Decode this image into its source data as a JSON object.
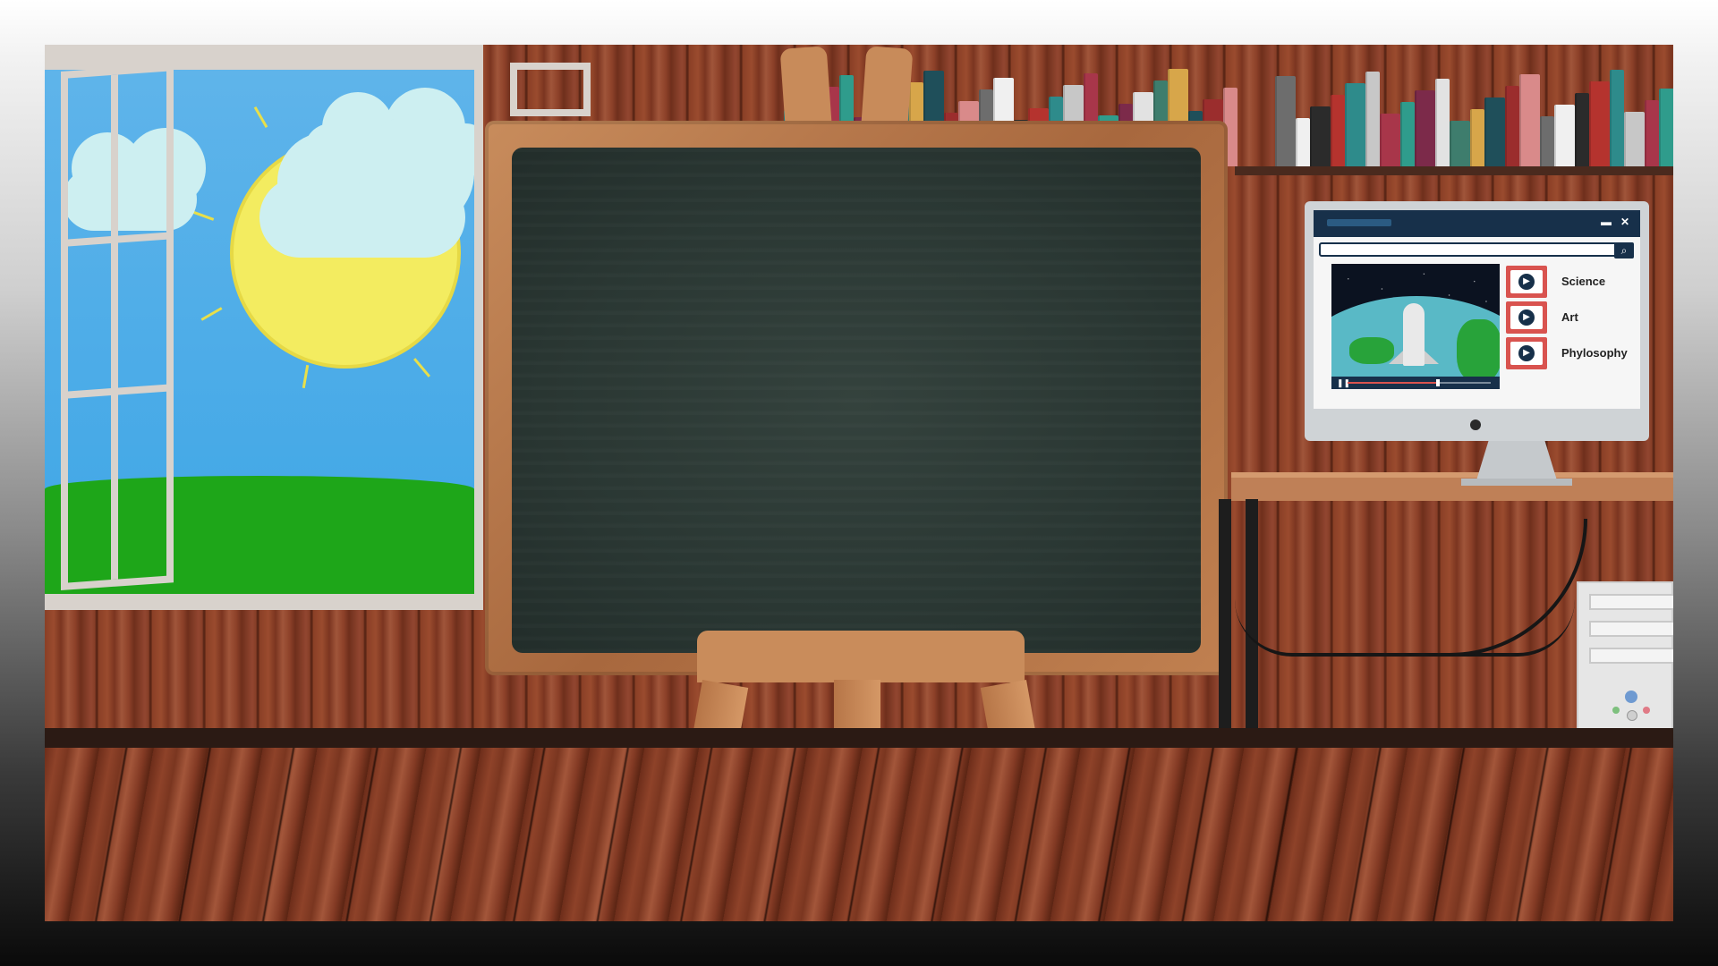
{
  "monitor": {
    "videos": [
      {
        "label": "Science"
      },
      {
        "label": "Art"
      },
      {
        "label": "Phylosophy"
      }
    ],
    "player": {
      "progress": 0.62
    },
    "icons": [
      "minimize-icon",
      "close-icon",
      "search-icon",
      "play-icon",
      "pause-icon"
    ]
  },
  "colors": {
    "sky": "#3ea6e6",
    "grass": "#1ea619",
    "sun": "#f3ec60",
    "chalkboard": "#2a3733",
    "frame_wood": "#c88c5c",
    "screen_header": "#17304a",
    "thumbnail_red": "#d9534f"
  }
}
